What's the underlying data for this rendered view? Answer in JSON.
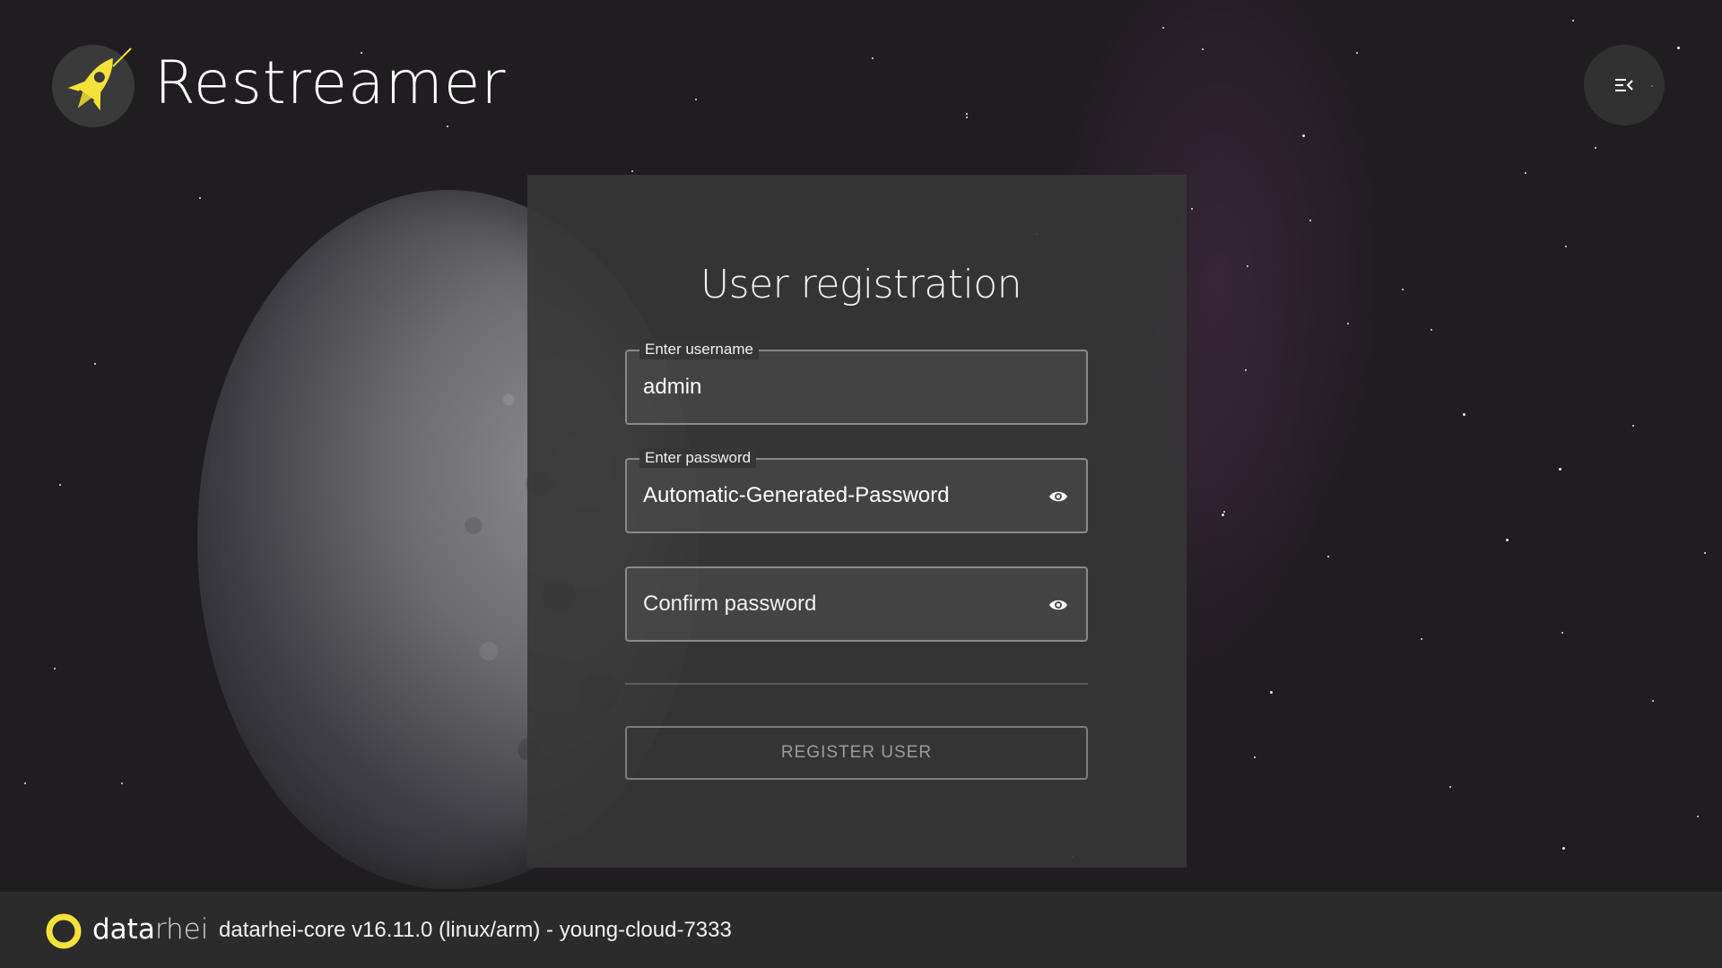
{
  "header": {
    "app_title": "Restreamer",
    "logo_icon": "rocket-icon",
    "menu_icon": "menu-collapse-icon"
  },
  "registration": {
    "title": "User registration",
    "username": {
      "label": "Enter username",
      "value": "admin"
    },
    "password": {
      "label": "Enter password",
      "value": "Automatic-Generated-Password",
      "toggle_icon": "eye-icon"
    },
    "confirm_password": {
      "placeholder": "Confirm password",
      "value": "",
      "toggle_icon": "eye-icon"
    },
    "register_label": "REGISTER USER"
  },
  "footer": {
    "brand_bold": "data",
    "brand_light": "rhei",
    "version": "datarhei-core v16.11.0 (linux/arm) - young-cloud-7333"
  },
  "colors": {
    "accent": "#f4e23a",
    "background": "#201d21",
    "card": "#363636",
    "footer": "#2b2b2b"
  }
}
